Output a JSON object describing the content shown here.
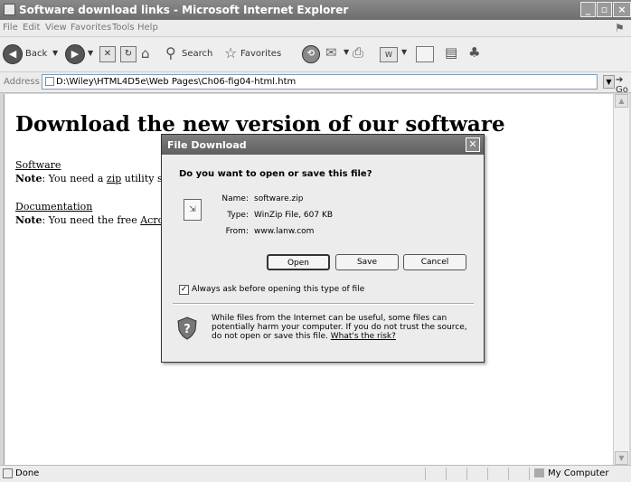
{
  "window": {
    "title": "Software download links - Microsoft Internet Explorer",
    "buttons": [
      "_",
      "▫",
      "×"
    ]
  },
  "menu": [
    "File",
    "Edit",
    "View",
    "Favorites",
    "Tools",
    "Help"
  ],
  "toolbar": {
    "back_label": "Back",
    "search_label": "Search",
    "favorites_label": "Favorites"
  },
  "address": {
    "label": "Address",
    "url": "D:\\Wiley\\HTML4D5e\\Web Pages\\Ch06-fig04-html.htm",
    "go_label": "Go"
  },
  "page": {
    "heading": "Download the new version of our software",
    "link1": "Software",
    "note1_label": "Note",
    "note1_pre": ": You need a ",
    "note1_link": "zip",
    "note1_post": " utility su",
    "link2": "Documentation",
    "note2_label": "Note",
    "note2_pre": ": You need the free ",
    "note2_link": "Acro"
  },
  "dialog": {
    "title": "File Download",
    "question": "Do you want to open or save this file?",
    "name_key": "Name:",
    "name_value": "software.zip",
    "type_key": "Type:",
    "type_value": "WinZip File, 607 KB",
    "from_key": "From:",
    "from_value": "www.lanw.com",
    "open_label": "Open",
    "save_label": "Save",
    "cancel_label": "Cancel",
    "checkbox_label": "Always ask before opening this type of file",
    "checkbox_checked": true,
    "warning_text": "While files from the Internet can be useful, some files can potentially harm your computer. If you do not trust the source, do not open or save this file. ",
    "warning_link": "What's the risk?"
  },
  "status": {
    "text": "Done",
    "zone": "My Computer"
  }
}
